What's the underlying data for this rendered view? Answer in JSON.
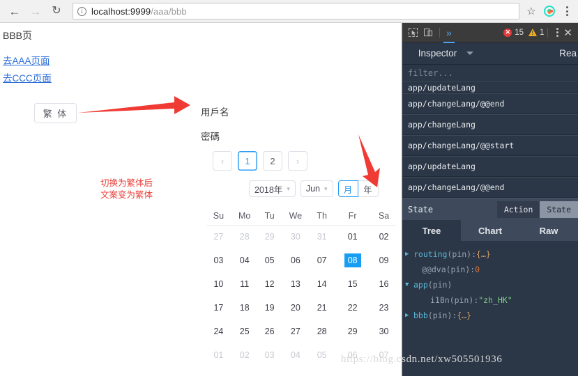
{
  "browser": {
    "back_icon": "arrow-left-icon",
    "forward_icon": "arrow-right-icon",
    "reload_icon": "reload-icon",
    "info_icon": "info-circle-icon",
    "url_host": "localhost:9999",
    "url_path": "/aaa/bbb",
    "star_icon": "bookmark-star-icon",
    "extension_icon": "extension-icon",
    "menu_icon": "kebab-menu-icon"
  },
  "page": {
    "title": "BBB页",
    "links": [
      {
        "label": "去AAA页面"
      },
      {
        "label": "去CCC页面"
      }
    ],
    "lang_button": "繁 体",
    "note_line1": "切换为繁体后",
    "note_line2": "文案变为繁体",
    "form": {
      "username_label": "用戶名",
      "password_label": "密碼"
    },
    "pagination": {
      "prev": "‹",
      "pages": [
        "1",
        "2"
      ],
      "active": "1",
      "next": "›"
    },
    "datepicker": {
      "year": "2018年",
      "month": "Jun",
      "chevron_icon": "chevron-down-icon",
      "mode_month": "月",
      "mode_year": "年",
      "mode_active": "月",
      "weekdays": [
        "Su",
        "Mo",
        "Tu",
        "We",
        "Th",
        "Fr",
        "Sa"
      ],
      "selected_day": "08",
      "weeks": [
        [
          {
            "d": "27",
            "off": true
          },
          {
            "d": "28",
            "off": true
          },
          {
            "d": "29",
            "off": true
          },
          {
            "d": "30",
            "off": true
          },
          {
            "d": "31",
            "off": true
          },
          {
            "d": "01",
            "off": false
          },
          {
            "d": "02",
            "off": false
          }
        ],
        [
          {
            "d": "03",
            "off": false
          },
          {
            "d": "04",
            "off": false
          },
          {
            "d": "05",
            "off": false
          },
          {
            "d": "06",
            "off": false
          },
          {
            "d": "07",
            "off": false
          },
          {
            "d": "08",
            "off": false
          },
          {
            "d": "09",
            "off": false
          }
        ],
        [
          {
            "d": "10",
            "off": false
          },
          {
            "d": "11",
            "off": false
          },
          {
            "d": "12",
            "off": false
          },
          {
            "d": "13",
            "off": false
          },
          {
            "d": "14",
            "off": false
          },
          {
            "d": "15",
            "off": false
          },
          {
            "d": "16",
            "off": false
          }
        ],
        [
          {
            "d": "17",
            "off": false
          },
          {
            "d": "18",
            "off": false
          },
          {
            "d": "19",
            "off": false
          },
          {
            "d": "20",
            "off": false
          },
          {
            "d": "21",
            "off": false
          },
          {
            "d": "22",
            "off": false
          },
          {
            "d": "23",
            "off": false
          }
        ],
        [
          {
            "d": "24",
            "off": false
          },
          {
            "d": "25",
            "off": false
          },
          {
            "d": "26",
            "off": false
          },
          {
            "d": "27",
            "off": false
          },
          {
            "d": "28",
            "off": false
          },
          {
            "d": "29",
            "off": false
          },
          {
            "d": "30",
            "off": false
          }
        ],
        [
          {
            "d": "01",
            "off": true
          },
          {
            "d": "02",
            "off": true
          },
          {
            "d": "03",
            "off": true
          },
          {
            "d": "04",
            "off": true
          },
          {
            "d": "05",
            "off": true
          },
          {
            "d": "06",
            "off": true
          },
          {
            "d": "07",
            "off": true
          }
        ]
      ]
    },
    "watermark": "https://blog.csdn.net/xw505501936"
  },
  "devtools": {
    "toolbar": {
      "inspect_icon": "inspect-element-icon",
      "device_icon": "device-toolbar-icon",
      "more_tabs": "»",
      "error_count": "15",
      "warning_count": "1",
      "error_glyph": "✕",
      "menu_icon": "kebab-menu-icon",
      "close_icon": "close-icon"
    },
    "panel_tab": "Inspector",
    "panel_tab_caret": "chevron-down-icon",
    "panel_tab_right": "Rea",
    "filter_placeholder": "filter...",
    "actions": [
      "app/updateLang",
      "app/changeLang/@@end",
      "app/changeLang",
      "app/changeLang/@@start",
      "app/updateLang",
      "app/changeLang/@@end"
    ],
    "state_bar": {
      "label": "State",
      "toggle": [
        "Action",
        "State"
      ],
      "active": "State"
    },
    "sub_tabs": [
      "Tree",
      "Chart",
      "Raw"
    ],
    "sub_tab_active": "Tree",
    "tree": [
      {
        "triangle": "▶",
        "key": "routing",
        "pin": "(pin)",
        "sep": ":",
        "value": "{…}",
        "vtype": "obj",
        "indent": 0,
        "kcls": "k-routing"
      },
      {
        "triangle": "",
        "key": "@@dva",
        "pin": "(pin)",
        "sep": ":",
        "value": "0",
        "vtype": "num",
        "indent": 1,
        "kcls": "k-dva"
      },
      {
        "triangle": "▼",
        "key": "app",
        "pin": "(pin)",
        "sep": "",
        "value": "",
        "vtype": "none",
        "indent": 0,
        "kcls": "k-app"
      },
      {
        "triangle": "",
        "key": "i18n",
        "pin": "(pin)",
        "sep": ":",
        "value": "\"zh_HK\"",
        "vtype": "str",
        "indent": 2,
        "kcls": "k-i18n"
      },
      {
        "triangle": "▶",
        "key": "bbb",
        "pin": "(pin)",
        "sep": ":",
        "value": "{…}",
        "vtype": "obj",
        "indent": 0,
        "kcls": "k-bbb"
      }
    ]
  },
  "colors": {
    "accent_blue": "#179ef4",
    "link_blue": "#2a6cd8",
    "annotation_red": "#e8413a",
    "devtools_bg": "#2b3646",
    "error_red": "#e03a3a",
    "warning_yellow": "#f2b01e"
  }
}
